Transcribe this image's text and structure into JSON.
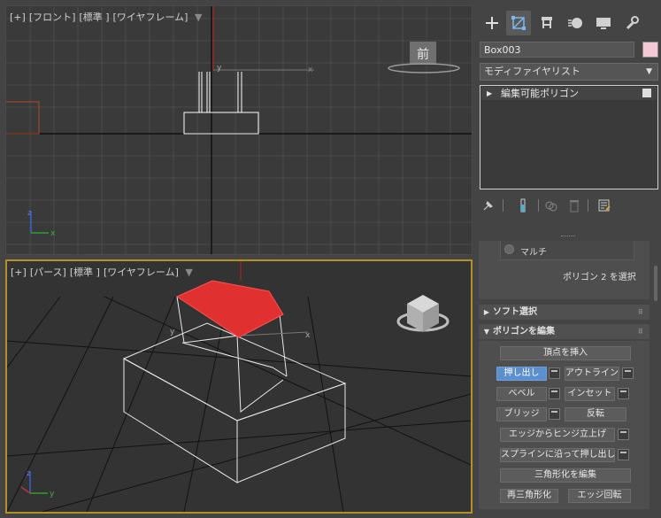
{
  "viewport_front": {
    "plus": "[+]",
    "view": "[フロント]",
    "shading": "[標準 ]",
    "mode": "[ワイヤフレーム]"
  },
  "viewport_persp": {
    "plus": "[+]",
    "view": "[パース]",
    "shading": "[標準 ]",
    "mode": "[ワイヤフレーム]"
  },
  "viewcube_front_label": "前",
  "axes": {
    "x": "x",
    "y": "y",
    "z": "z"
  },
  "colors": {
    "selected_face": "#e03030",
    "viewport_active_border": "#b49028",
    "swatch": "#f4c9d6",
    "button_active": "#5b8fce"
  },
  "tabs": [
    "create-icon",
    "modify-icon",
    "hierarchy-icon",
    "motion-icon",
    "display-icon",
    "utilities-icon"
  ],
  "object_name": "Box003",
  "modifier_list": "モディファイヤリスト",
  "stack": [
    {
      "label": "編集可能ポリゴン"
    }
  ],
  "stack_tools": [
    "pin-stack-icon",
    "show-end-result-icon",
    "make-unique-icon",
    "remove-modifier-icon",
    "configure-sets-icon"
  ],
  "selection": {
    "multi_label": "マルチ",
    "status": "ポリゴン 2 を選択"
  },
  "soft_select": {
    "title": "ソフト選択"
  },
  "edit_polygons": {
    "title": "ポリゴンを編集",
    "insert_vertex": "頂点を挿入",
    "extrude": "押し出し",
    "outline": "アウトライン",
    "bevel": "ベベル",
    "inset": "インセット",
    "bridge": "ブリッジ",
    "flip": "反転",
    "hinge": "エッジからヒンジ立上げ",
    "extrude_spline": "スプラインに沿って押し出し",
    "edit_tri": "三角形化を編集",
    "retriangulate": "再三角形化",
    "turn": "エッジ回転"
  }
}
